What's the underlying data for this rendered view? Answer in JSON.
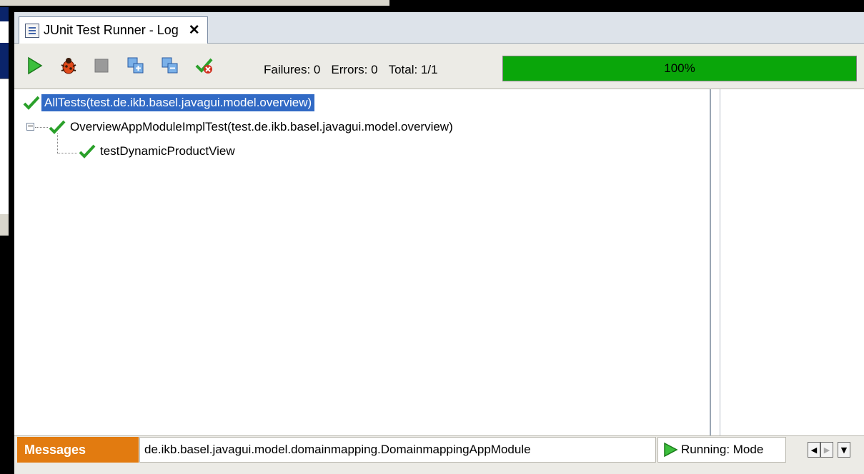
{
  "window": {
    "tab_title": "JUnit Test Runner - Log",
    "tab_close": "✕"
  },
  "toolbar": {
    "failures_label": "Failures: 0",
    "errors_label": "Errors: 0",
    "total_label": "Total: 1/1",
    "progress_text": "100%",
    "progress_value": 1.0,
    "buttons": [
      "run-icon",
      "debug-bug-icon",
      "stop-icon",
      "expand-all-icon",
      "collapse-all-icon",
      "rerun-failed-icon"
    ]
  },
  "tree": {
    "nodes": [
      {
        "label": "AllTests(test.de.ikb.basel.javagui.model.overview)",
        "status": "passed",
        "selected": true
      },
      {
        "label": "OverviewAppModuleImplTest(test.de.ikb.basel.javagui.model.overview)",
        "status": "passed",
        "expander": "−"
      },
      {
        "label": "testDynamicProductView",
        "status": "passed"
      }
    ]
  },
  "statusbar": {
    "messages_tab": "Messages",
    "path": "de.ikb.basel.javagui.model.domainmapping.DomainmappingAppModule",
    "running": "Running: Mode",
    "nav_left": "◀",
    "nav_right": "▶",
    "nav_down": "▼"
  },
  "colors": {
    "progress_green": "#0aa60a",
    "selection_blue": "#316ac5",
    "messages_orange": "#e27b10"
  }
}
